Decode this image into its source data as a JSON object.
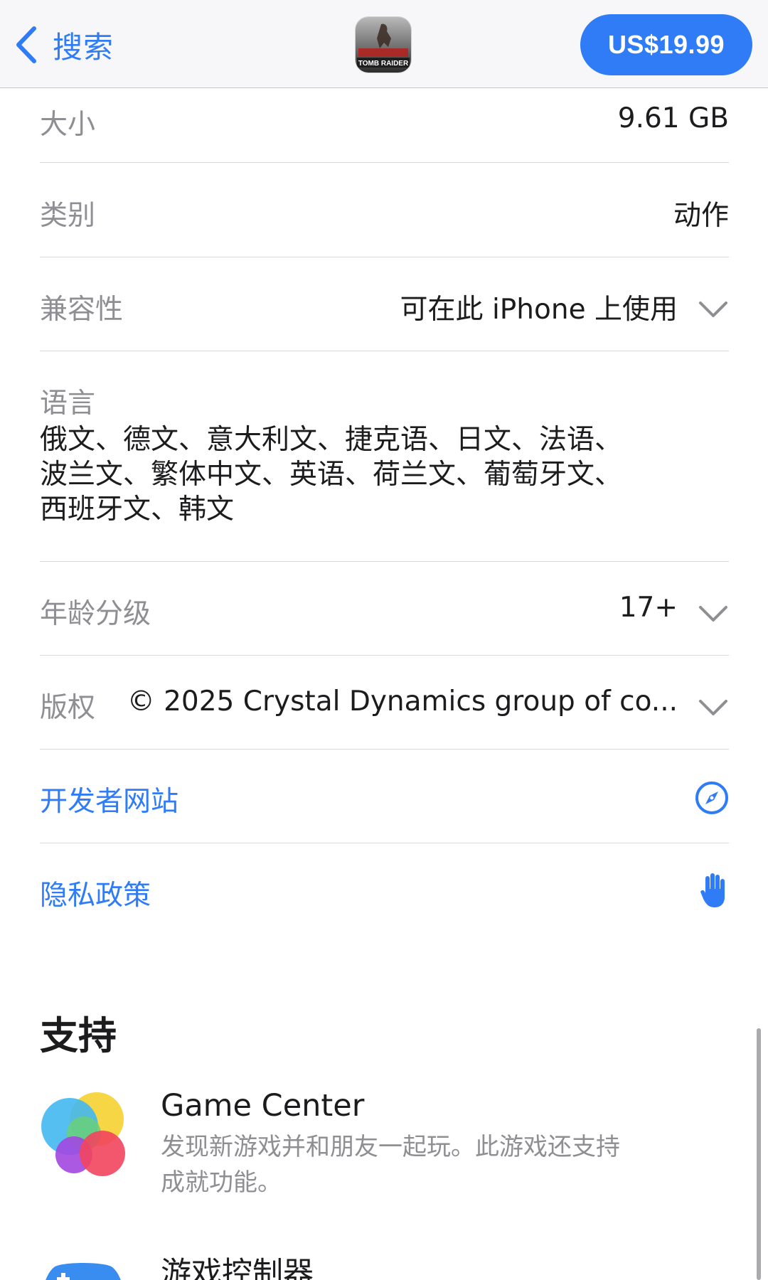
{
  "nav": {
    "back_label": "搜索",
    "app_icon_text": "TOMB RAIDER",
    "price_label": "US$19.99"
  },
  "info": {
    "size": {
      "label": "大小",
      "value": "9.61 GB"
    },
    "category": {
      "label": "类别",
      "value": "动作"
    },
    "compatibility": {
      "label": "兼容性",
      "value": "可在此 iPhone 上使用"
    },
    "languages": {
      "label": "语言",
      "lines": [
        "俄文、德文、意大利文、捷克语、日文、法语、",
        "波兰文、繁体中文、英语、荷兰文、葡萄牙文、",
        "西班牙文、韩文"
      ]
    },
    "age_rating": {
      "label": "年龄分级",
      "value": "17+"
    },
    "copyright": {
      "label": "版权",
      "value": "© 2025 Crystal Dynamics group of co..."
    },
    "developer_site": {
      "label": "开发者网站",
      "icon": "compass-icon"
    },
    "privacy_policy": {
      "label": "隐私政策",
      "icon": "hand-icon"
    }
  },
  "support": {
    "title": "支持",
    "items": [
      {
        "title": "Game Center",
        "description_lines": [
          "发现新游戏并和朋友一起玩。此游戏还支持",
          "成就功能。"
        ],
        "icon": "game-center-icon"
      },
      {
        "title": "游戏控制器",
        "icon": "game-controller-icon"
      }
    ]
  },
  "colors": {
    "accent": "#2f7cf6",
    "secondary_text": "#8e8e93",
    "primary_text": "#1c1c1e",
    "nav_background": "#f7f7f9"
  }
}
